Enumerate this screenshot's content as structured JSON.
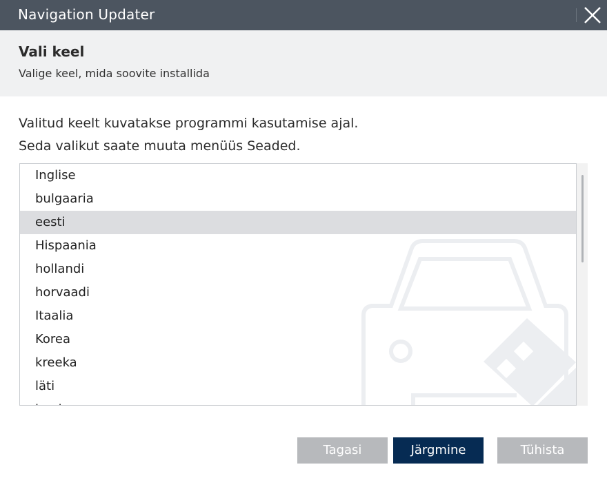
{
  "window": {
    "title": "Navigation Updater",
    "close_icon": "close-icon"
  },
  "header": {
    "title": "Vali keel",
    "subtitle": "Valige keel, mida soovite installida"
  },
  "description": {
    "line1": "Valitud keelt kuvatakse programmi kasutamise ajal.",
    "line2": "Seda valikut saate muuta menüüs Seaded."
  },
  "language_list": {
    "items": [
      "Inglise",
      "bulgaaria",
      "eesti",
      "Hispaania",
      "hollandi",
      "horvaadi",
      "Itaalia",
      "Korea",
      "kreeka",
      "läti",
      "leedu"
    ],
    "selected": "eesti"
  },
  "buttons": {
    "back": "Tagasi",
    "next": "Järgmine",
    "cancel": "Tühista"
  },
  "colors": {
    "titlebar": "#4c5560",
    "header_band": "#f0f1f2",
    "selected_row": "#dcdde0",
    "primary_button": "#062b53",
    "disabled_button": "#b7b9bc"
  }
}
